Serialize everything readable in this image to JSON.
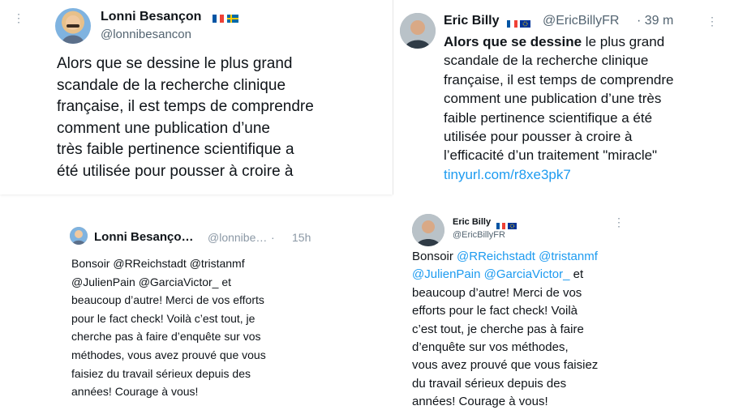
{
  "tweet_a": {
    "author": "Lonni Besançon",
    "handle": "@lonnibesancon",
    "text": "Alors que se dessine le plus grand\nscandale de la recherche clinique\nfrançaise, il est temps de comprendre\ncomment une publication d’une\ntrès faible pertinence scientifique a\nété utilisée pour pousser à croire à"
  },
  "tweet_b": {
    "author": "Eric Billy",
    "handle": "@EricBillyFR",
    "time": "· 39 m",
    "text_bold": "Alors que se dessine",
    "text_rest": " le plus grand\nscandale de la recherche clinique\nfrançaise, il est temps de comprendre\ncomment une publication d’une très\nfaible pertinence scientifique a été\nutilisée pour pousser à croire à\nl’efficacité d’un traitement \"miracle\"",
    "link": "tinyurl.com/r8xe3pk7"
  },
  "tweet_c": {
    "author": "Lonni Besanço…",
    "handle": "@lonnibe…",
    "time": "15h",
    "text": "Bonsoir @RReichstadt @tristanmf\n@JulienPain @GarciaVictor_ et\nbeaucoup d’autre! Merci de vos efforts\npour le fact check! Voilà c’est tout, je\ncherche pas à faire d’enquête sur vos\nméthodes, vous avez prouvé que vous\nfaisiez du travail sérieux depuis des\nannées! Courage à vous!"
  },
  "tweet_d": {
    "author": "Eric Billy",
    "handle": "@EricBillyFR",
    "greeting": "Bonsoir ",
    "m1": "@RReichstadt",
    "m2": "@tristanmf",
    "m3": "@JulienPain",
    "m4": "@GarciaVictor_",
    "after": " et",
    "text": "beaucoup d’autre! Merci de vos\nefforts pour le fact check! Voilà\nc’est tout, je cherche pas à faire\nd’enquête sur vos méthodes,\nvous avez prouvé que vous faisiez\ndu travail sérieux depuis des\nannées! Courage à vous!"
  },
  "more_icon": "⋮",
  "colors": {
    "link": "#1d9bf0",
    "muted": "#536471",
    "divider": "#e6e6e6"
  }
}
